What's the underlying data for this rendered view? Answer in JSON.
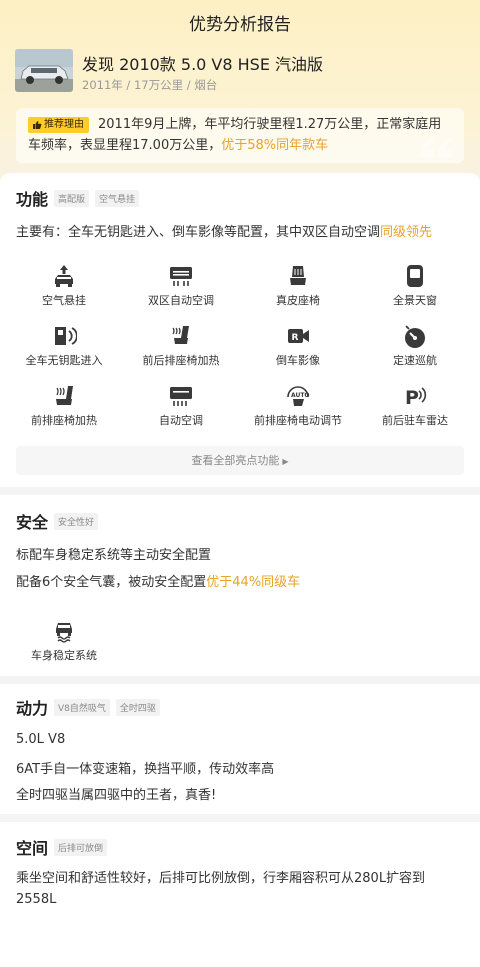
{
  "header": {
    "title": "优势分析报告"
  },
  "car": {
    "name": "发现 2010款 5.0 V8 HSE 汽油版",
    "meta": "2011年 / 17万公里 / 烟台"
  },
  "recommend": {
    "badge": "推荐理由",
    "text": "2011年9月上牌，年平均行驶里程1.27万公里，正常家庭用车频率，表显里程17.00万公里，",
    "highlight": "优于58%同年款车"
  },
  "features": {
    "title": "功能",
    "tags": [
      "高配版",
      "空气悬挂"
    ],
    "summary_prefix": "主要有：全车无钥匙进入、倒车影像等配置，其中双区自动空调",
    "summary_highlight": "同级领先",
    "items": [
      {
        "label": "空气悬挂",
        "icon": "air-suspension-icon"
      },
      {
        "label": "双区自动空调",
        "icon": "dual-zone-ac-icon"
      },
      {
        "label": "真皮座椅",
        "icon": "leather-seat-icon"
      },
      {
        "label": "全景天窗",
        "icon": "panoramic-sunroof-icon"
      },
      {
        "label": "全车无钥匙进入",
        "icon": "keyless-entry-icon"
      },
      {
        "label": "前后排座椅加热",
        "icon": "seat-heating-icon"
      },
      {
        "label": "倒车影像",
        "icon": "reverse-camera-icon"
      },
      {
        "label": "定速巡航",
        "icon": "cruise-control-icon"
      },
      {
        "label": "前排座椅加热",
        "icon": "front-seat-heating-icon"
      },
      {
        "label": "自动空调",
        "icon": "auto-ac-icon"
      },
      {
        "label": "前排座椅电动调节",
        "icon": "power-seat-icon"
      },
      {
        "label": "前后驻车雷达",
        "icon": "parking-radar-icon"
      }
    ],
    "more_label": "查看全部亮点功能"
  },
  "safety": {
    "title": "安全",
    "tags": [
      "安全性好"
    ],
    "line1": "标配车身稳定系统等主动安全配置",
    "line2_prefix": "配备6个安全气囊，被动安全配置",
    "line2_highlight": "优于44%同级车",
    "items": [
      {
        "label": "车身稳定系统",
        "icon": "stability-control-icon"
      }
    ]
  },
  "power": {
    "title": "动力",
    "tags": [
      "V8自然吸气",
      "全时四驱"
    ],
    "lines": [
      "5.0L V8",
      "6AT手自一体变速箱，换挡平顺，传动效率高",
      "全时四驱当属四驱中的王者，真香!"
    ]
  },
  "space": {
    "title": "空间",
    "tags": [
      "后排可放倒"
    ],
    "text": "乘坐空间和舒适性较好，后排可比例放倒，行李厢容积可从280L扩容到2558L"
  },
  "colors": {
    "highlight": "#e7a32a",
    "badge": "#ffcc2c",
    "hero_bg": "#fdf0c4"
  }
}
